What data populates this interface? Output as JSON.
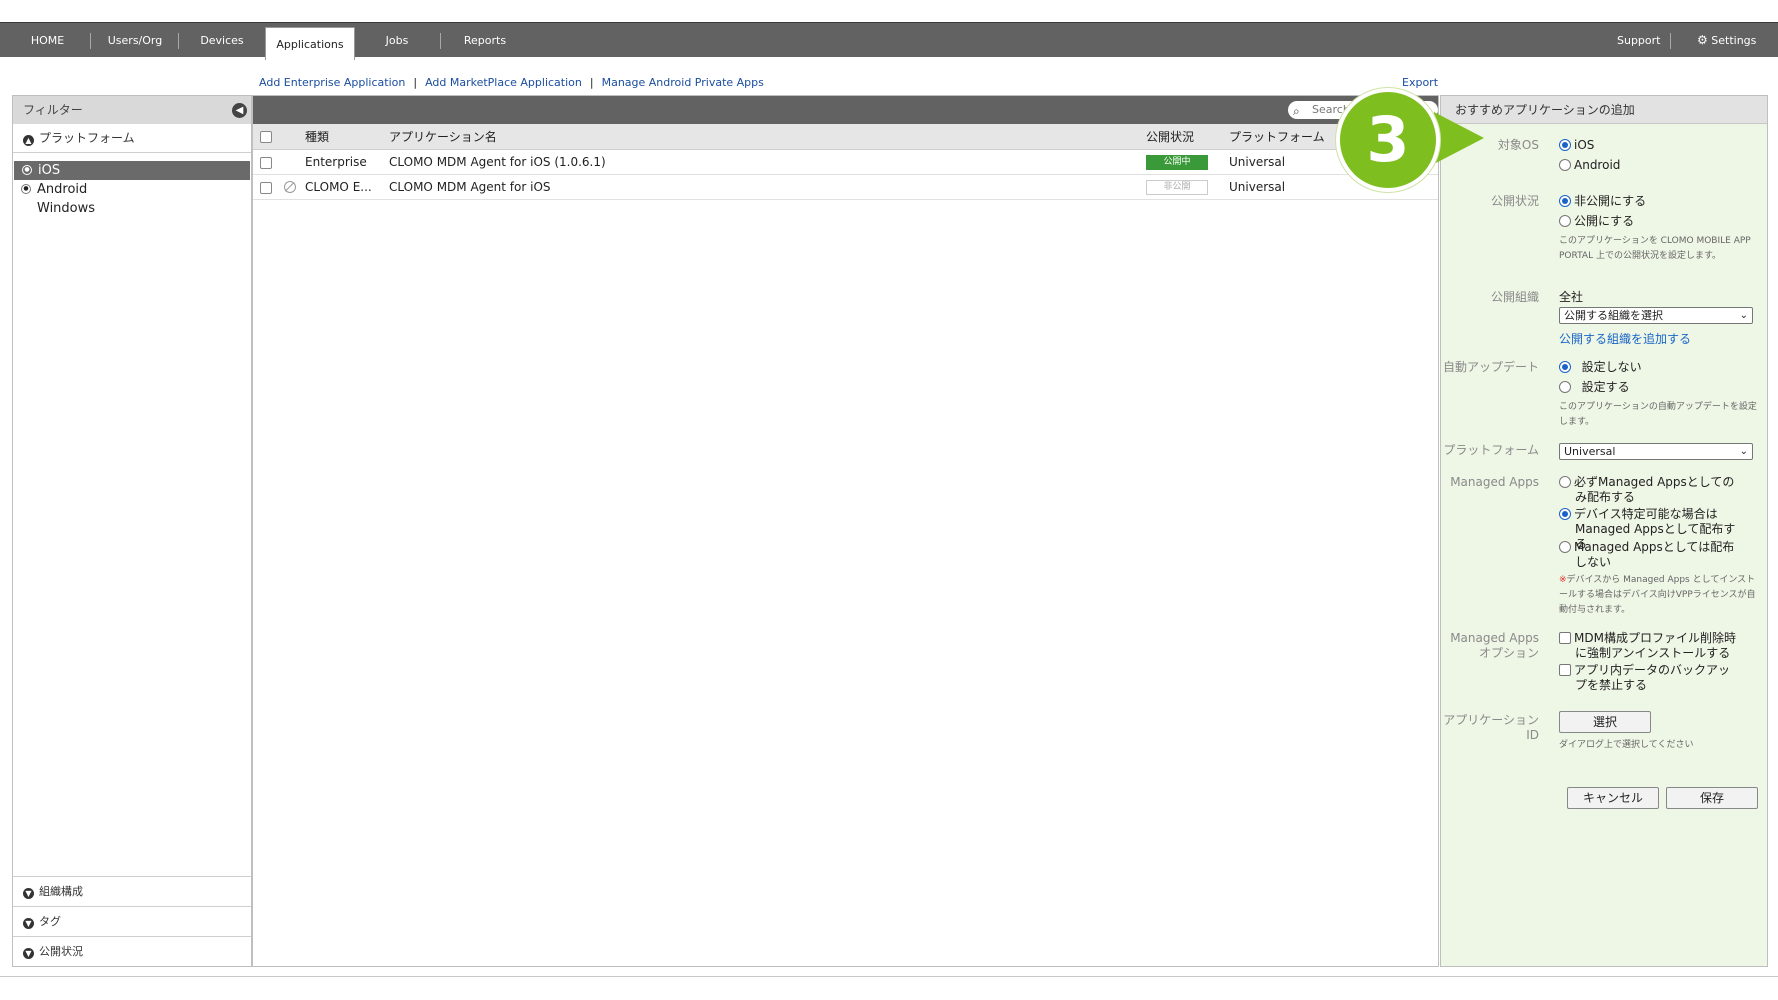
{
  "nav": {
    "tabs": [
      "HOME",
      "Users/Org",
      "Devices",
      "Applications",
      "Jobs",
      "Reports"
    ],
    "active_tab": "Applications",
    "support": "Support",
    "settings": "Settings"
  },
  "actions": {
    "add_enterprise": "Add Enterprise Application",
    "add_marketplace": "Add MarketPlace Application",
    "manage_android": "Manage Android Private Apps",
    "export": "Export"
  },
  "filter": {
    "title": "フィルター",
    "platform_section": "プラットフォーム",
    "platforms": [
      "iOS",
      "Android",
      "Windows"
    ],
    "selected_platform": "iOS",
    "bottom_sections": [
      "組織構成",
      "タグ",
      "公開状況"
    ]
  },
  "table": {
    "search_placeholder": "Search",
    "columns": [
      "種類",
      "アプリケーション名",
      "公開状況",
      "プラットフォーム"
    ],
    "rows": [
      {
        "type": "Enterprise",
        "name": "CLOMO MDM Agent for iOS (1.0.6.1)",
        "status": "公開中",
        "platform": "Universal"
      },
      {
        "type": "CLOMO E...",
        "name": "CLOMO MDM Agent for iOS",
        "status": "非公開",
        "platform": "Universal"
      }
    ]
  },
  "panel": {
    "title": "おすすめアプリケーションの追加",
    "target_os_label": "対象OS",
    "target_os_options": [
      "iOS",
      "Android"
    ],
    "publish_label": "公開状況",
    "publish_options": [
      "非公開にする",
      "公開にする"
    ],
    "publish_note": "このアプリケーションを CLOMO MOBILE APP PORTAL 上での公開状況を設定します。",
    "org_label": "公開組織",
    "org_value": "全社",
    "org_select": "公開する組織を選択",
    "org_add_link": "公開する組織を追加する",
    "auto_update_label": "自動アップデート",
    "auto_update_options": [
      "設定しない",
      "設定する"
    ],
    "auto_update_note": "このアプリケーションの自動アップデートを設定します。",
    "platform_label": "プラットフォーム",
    "platform_select": "Universal",
    "managed_label": "Managed Apps",
    "managed_options": [
      "必ずManaged Appsとしてのみ配布する",
      "デバイス特定可能な場合はManaged Appsとして配布する",
      "Managed Appsとしては配布しない"
    ],
    "managed_note_mark": "※",
    "managed_note": "デバイスから Managed Apps としてインストールする場合はデバイス向けVPPライセンスが自動付与されます。",
    "managed_opt_label_1": "Managed Apps",
    "managed_opt_label_2": "オプション",
    "managed_opt_options": [
      "MDM構成プロファイル削除時に強制アンインストールする",
      "アプリ内データのバックアップを禁止する"
    ],
    "app_id_label_1": "アプリケーション",
    "app_id_label_2": "ID",
    "select_button": "選択",
    "select_note": "ダイアログ上で選択してください",
    "cancel_button": "キャンセル",
    "save_button": "保存"
  },
  "step_marker": "3",
  "colors": {
    "accent_green": "#7fbe1f",
    "nav_bg": "#626262",
    "link_blue": "#1a4ea0",
    "status_published": "#3a9a3a"
  }
}
